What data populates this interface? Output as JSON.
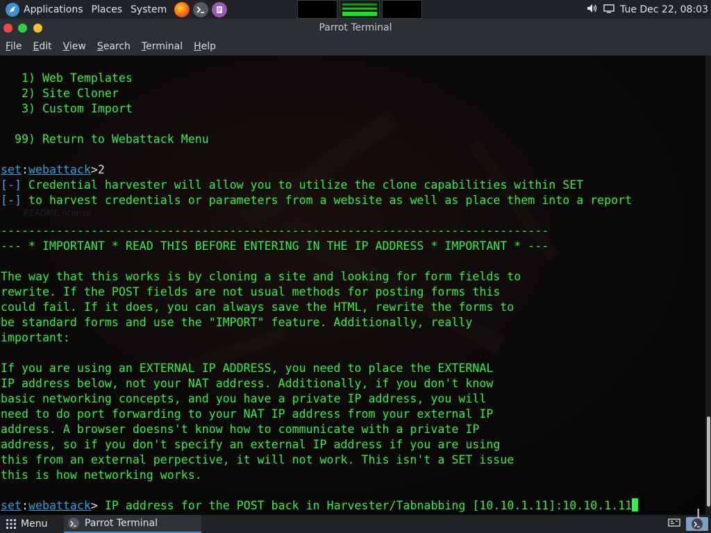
{
  "top_panel": {
    "menus": [
      "Applications",
      "Places",
      "System"
    ],
    "datetime": "Tue Dec 22, 08:03"
  },
  "window": {
    "title": "Parrot Terminal"
  },
  "menubar": {
    "items": [
      {
        "u": "F",
        "rest": "ile"
      },
      {
        "u": "E",
        "rest": "dit"
      },
      {
        "u": "V",
        "rest": "iew"
      },
      {
        "u": "S",
        "rest": "earch"
      },
      {
        "u": "T",
        "rest": "erminal"
      },
      {
        "u": "H",
        "rest": "elp"
      }
    ]
  },
  "terminal": {
    "menu_options": [
      "   1) Web Templates",
      "   2) Site Cloner",
      "   3) Custom Import",
      "",
      "  99) Return to Webattack Menu",
      ""
    ],
    "prompt": {
      "set": "set",
      "colon": ":",
      "module": "webattack",
      "gt": ">",
      "input": "2"
    },
    "info_lines": [
      {
        "tag": "[-]",
        "text": " Credential harvester will allow you to utilize the clone capabilities within SET"
      },
      {
        "tag": "[-]",
        "text": " to harvest credentials or parameters from a website as well as place them into a report"
      }
    ],
    "rule": "-------------------------------------------------------------------------------",
    "important": "--- * IMPORTANT * READ THIS BEFORE ENTERING IN THE IP ADDRESS * IMPORTANT * ---",
    "paragraph1": [
      "The way that this works is by cloning a site and looking for form fields to",
      "rewrite. If the POST fields are not usual methods for posting forms this",
      "could fail. If it does, you can always save the HTML, rewrite the forms to",
      "be standard forms and use the \"IMPORT\" feature. Additionally, really",
      "important:"
    ],
    "paragraph2": [
      "If you are using an EXTERNAL IP ADDRESS, you need to place the EXTERNAL",
      "IP address below, not your NAT address. Additionally, if you don't know",
      "basic networking concepts, and you have a private IP address, you will",
      "need to do port forwarding to your NAT IP address from your external IP",
      "address. A browser doesns't know how to communicate with a private IP",
      "address, so if you don't specify an external IP address if you are using",
      "this from an external perpective, it will not work. This isn't a SET issue",
      "this is how networking works."
    ],
    "final_prompt": {
      "set": "set",
      "colon": ":",
      "module": "webattack",
      "gt": ">",
      "question": " IP address for the POST back in Harvester/Tabnabbing [10.10.1.11]:",
      "input": "10.10.1.11"
    },
    "desktop_ghost_file": "README.license"
  },
  "bottom_panel": {
    "menu_label": "Menu",
    "task_label": "Parrot Terminal"
  },
  "colors": {
    "terminal_green": "#37ee47",
    "prompt_blue": "#2ea0df",
    "panel_bg": "#1f2326"
  }
}
